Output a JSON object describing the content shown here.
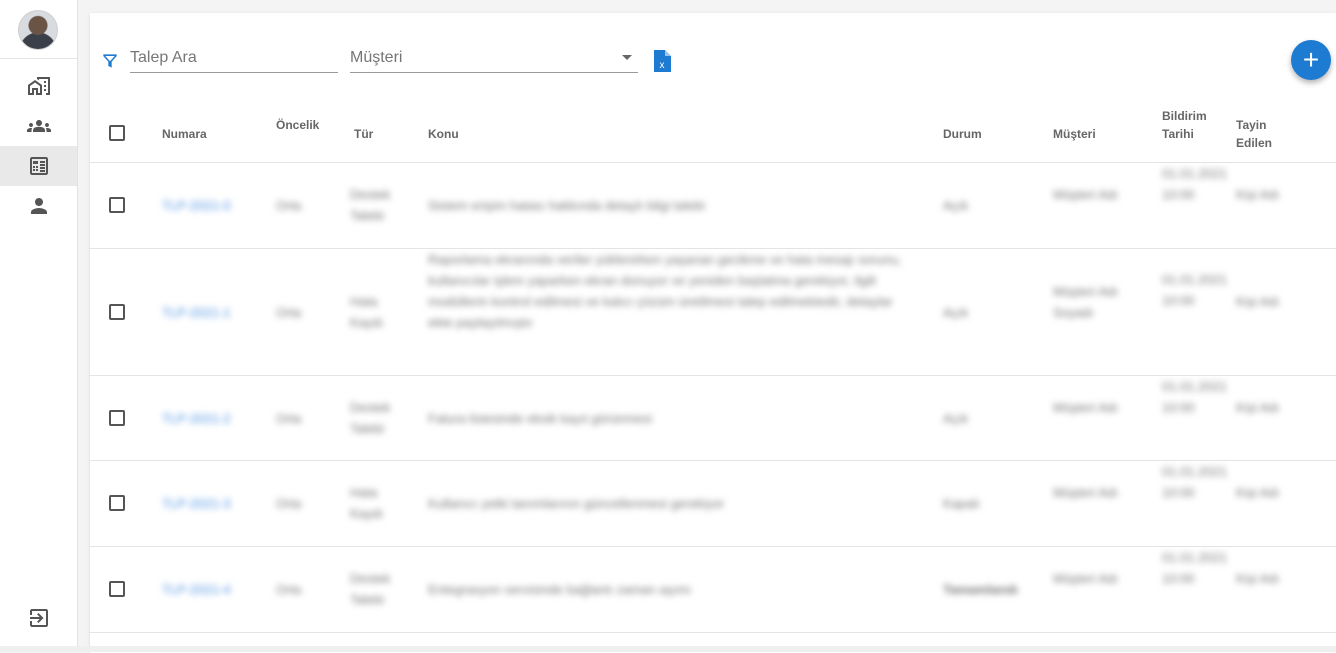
{
  "sidebar": {
    "items": [
      {
        "name": "buildings",
        "icon": "buildings-icon",
        "active": false
      },
      {
        "name": "team",
        "icon": "people-group-icon",
        "active": false
      },
      {
        "name": "calculator",
        "icon": "calculator-icon",
        "active": true
      },
      {
        "name": "profile",
        "icon": "person-icon",
        "active": false
      }
    ],
    "logout_icon": "logout-icon"
  },
  "toolbar": {
    "search_placeholder": "Talep Ara",
    "customer_placeholder": "Müşteri",
    "filter_icon": "filter-icon",
    "excel_icon": "excel-export-icon",
    "add_label": "+"
  },
  "table": {
    "columns": [
      "Numara",
      "Öncelik",
      "Tür",
      "Konu",
      "Durum",
      "Müşteri",
      "Bildirim Tarihi",
      "Tayin Edilen"
    ],
    "rows": [
      {
        "numara": "TLP-2021-0",
        "oncelik": "Orta",
        "tur": "Destek Talebi",
        "konu": "Sistem erişim hatası hakkında detaylı bilgi talebi",
        "durum": "Açık",
        "musteri": "Müşteri Adı",
        "tarih": "01.01.2021 10:00",
        "tayin": "Kişi Adı"
      },
      {
        "numara": "TLP-2021-1",
        "oncelik": "Orta",
        "tur": "Hata Kaydı",
        "konu": "Raporlama ekranında veriler yüklenirken yaşanan gecikme ve hata mesajı sorunu, kullanıcılar işlem yaparken ekran donuyor ve yeniden başlatma gerekiyor, ilgili modüllerin kontrol edilmesi ve kalıcı çözüm üretilmesi talep edilmektedir, detaylar ekte paylaşılmıştır",
        "durum": "Açık",
        "musteri": "Müşteri Adı Soyadı",
        "tarih": "01.01.2021 10:00",
        "tayin": "Kişi Adı"
      },
      {
        "numara": "TLP-2021-2",
        "oncelik": "Orta",
        "tur": "Destek Talebi",
        "konu": "Fatura listesinde eksik kayıt görünmesi",
        "durum": "Açık",
        "musteri": "Müşteri Adı",
        "tarih": "01.01.2021 10:00",
        "tayin": "Kişi Adı"
      },
      {
        "numara": "TLP-2021-3",
        "oncelik": "Orta",
        "tur": "Hata Kaydı",
        "konu": "Kullanıcı yetki tanımlarının güncellenmesi gerekiyor",
        "durum": "Kapalı",
        "musteri": "Müşteri Adı",
        "tarih": "01.01.2021 10:00",
        "tayin": "Kişi Adı"
      },
      {
        "numara": "TLP-2021-4",
        "oncelik": "Orta",
        "tur": "Destek Talebi",
        "konu": "Entegrasyon servisinde bağlantı zaman aşımı",
        "durum": "Tamamlandı",
        "musteri": "Müşteri Adı",
        "tarih": "01.01.2021 10:00",
        "tayin": "Kişi Adı"
      }
    ]
  }
}
